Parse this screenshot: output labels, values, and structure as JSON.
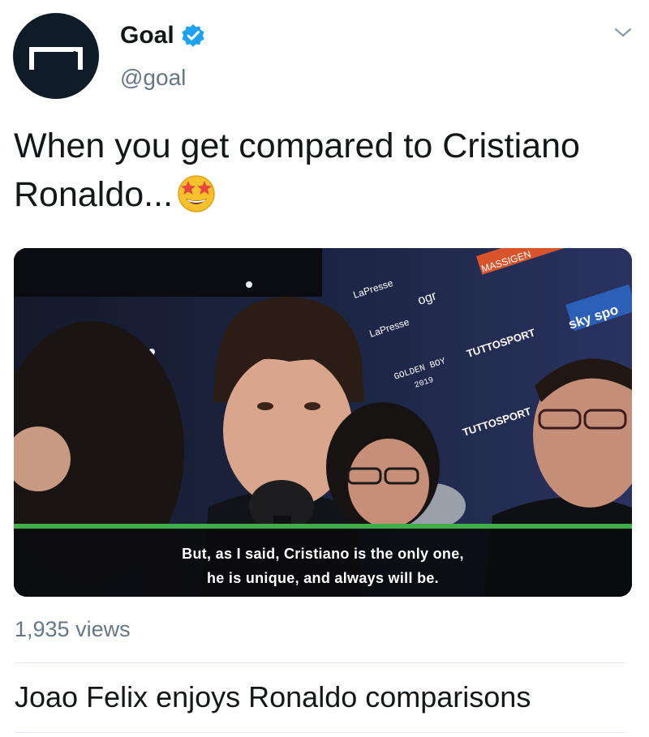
{
  "author": {
    "display_name": "Goal",
    "handle": "@goal",
    "verified": true,
    "verified_icon": "verified-badge-icon",
    "avatar_icon": "goal-logo-icon"
  },
  "tweet": {
    "text": "When you get compared to Cristiano Ronaldo...",
    "emoji": "star-struck-emoji"
  },
  "video": {
    "subtitle_line1": "But, as I said, Cristiano is the only one,",
    "subtitle_line2": "he is unique, and always will be.",
    "backdrop_logos": [
      "LaPresse",
      "ogr",
      "GOLDEN BOY",
      "2019",
      "TUTTOSPORT",
      "sky spo",
      "MASSIGEN"
    ]
  },
  "stats": {
    "views": "1,935 views"
  },
  "card": {
    "title": "Joao Felix enjoys Ronaldo comparisons"
  },
  "colors": {
    "verified_blue": "#1da1f2",
    "text_primary": "#14171a",
    "text_secondary": "#657786",
    "subtitle_accent": "#3fae49"
  }
}
